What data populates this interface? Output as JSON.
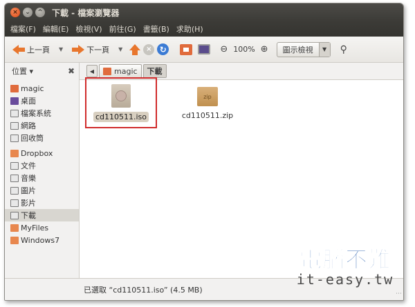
{
  "window": {
    "title": "下載 - 檔案瀏覽器",
    "close_glyph": "×",
    "min_glyph": "⌄",
    "max_glyph": "^"
  },
  "menubar": {
    "items": [
      "檔案(F)",
      "編輯(E)",
      "檢視(V)",
      "前往(G)",
      "書籤(B)",
      "求助(H)"
    ]
  },
  "toolbar": {
    "back_label": "上一頁",
    "forward_label": "下一頁",
    "zoom_level": "100%",
    "view_mode": "圖示檢視",
    "drop_glyph": "▼",
    "stop_glyph": "×",
    "reload_glyph": "↻",
    "zoom_out_glyph": "🔍−",
    "zoom_in_glyph": "⊕",
    "search_glyph": "🔍"
  },
  "sidebar": {
    "header": "位置 ▾",
    "close_glyph": "✖",
    "items": [
      "magic",
      "桌面",
      "檔案系統",
      "網路",
      "回收筒",
      "Dropbox",
      "文件",
      "音樂",
      "圖片",
      "影片",
      "下載",
      "MyFiles",
      "Windows7"
    ],
    "active_index": 10
  },
  "pathbar": {
    "back_glyph": "◀",
    "crumbs": [
      "magic",
      "下載"
    ]
  },
  "files": [
    {
      "name": "cd110511.iso",
      "selected": true
    },
    {
      "name": "cd110511.zip",
      "selected": false,
      "badge": "zip"
    }
  ],
  "status": {
    "text": "已選取 “cd110511.iso” (4.5 MB)"
  },
  "watermark": {
    "title": "電腦不難",
    "subtitle": "it-easy.tw"
  },
  "colors": {
    "accent": "#e8762d",
    "titlebar": "#3c3b37",
    "highlight": "#d02a2a",
    "watermark": "#3d6fb5"
  }
}
